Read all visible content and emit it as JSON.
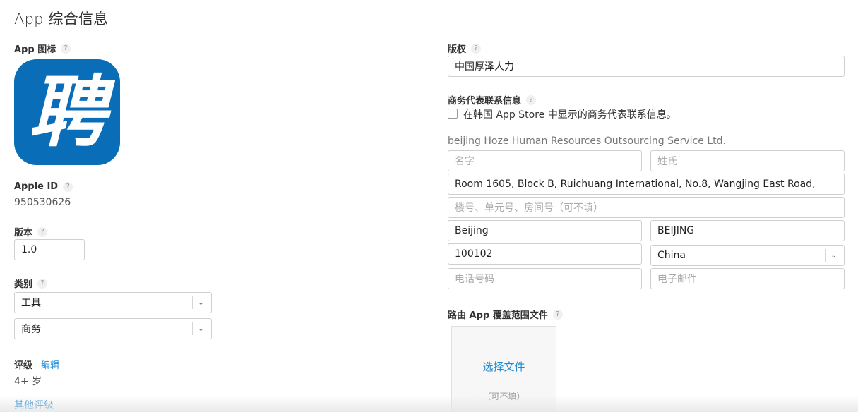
{
  "page": {
    "title": "App 综合信息"
  },
  "left": {
    "app_icon": {
      "label": "App 图标",
      "help": "?",
      "glyph": "聘",
      "bg_color": "#0a6db7"
    },
    "apple_id": {
      "label": "Apple ID",
      "help": "?",
      "value": "950530626"
    },
    "version": {
      "label": "版本",
      "help": "?",
      "value": "1.0"
    },
    "category": {
      "label": "类别",
      "help": "?",
      "primary": "工具",
      "secondary": "商务",
      "chevron": "⌄"
    },
    "rating": {
      "label": "评级",
      "edit_link": "编辑",
      "value": "4+ 岁",
      "other_link": "其他评级"
    }
  },
  "right": {
    "copyright": {
      "label": "版权",
      "help": "?",
      "value": "中国厚泽人力"
    },
    "contact": {
      "label": "商务代表联系信息",
      "help": "?",
      "checkbox_label": "在韩国 App Store 中显示的商务代表联系信息。",
      "company": "beijing Hoze Human Resources Outsourcing Service Ltd.",
      "first_name_placeholder": "名字",
      "last_name_placeholder": "姓氏",
      "address_line1": "Room 1605, Block B, Ruichuang International, No.8, Wangjing East Road,",
      "address_line2_placeholder": "楼号、单元号、房间号（可不填）",
      "city": "Beijing",
      "state": "BEIJING",
      "postal_code": "100102",
      "country": "China",
      "phone_placeholder": "电话号码",
      "email_placeholder": "电子邮件"
    },
    "routing": {
      "label": "路由 App 覆盖范围文件",
      "help": "?",
      "choose_file": "选择文件",
      "optional": "（可不填）"
    }
  },
  "colors": {
    "accent": "#1d8ad8",
    "border": "#cfcfcf",
    "placeholder": "#aaaaaa"
  }
}
